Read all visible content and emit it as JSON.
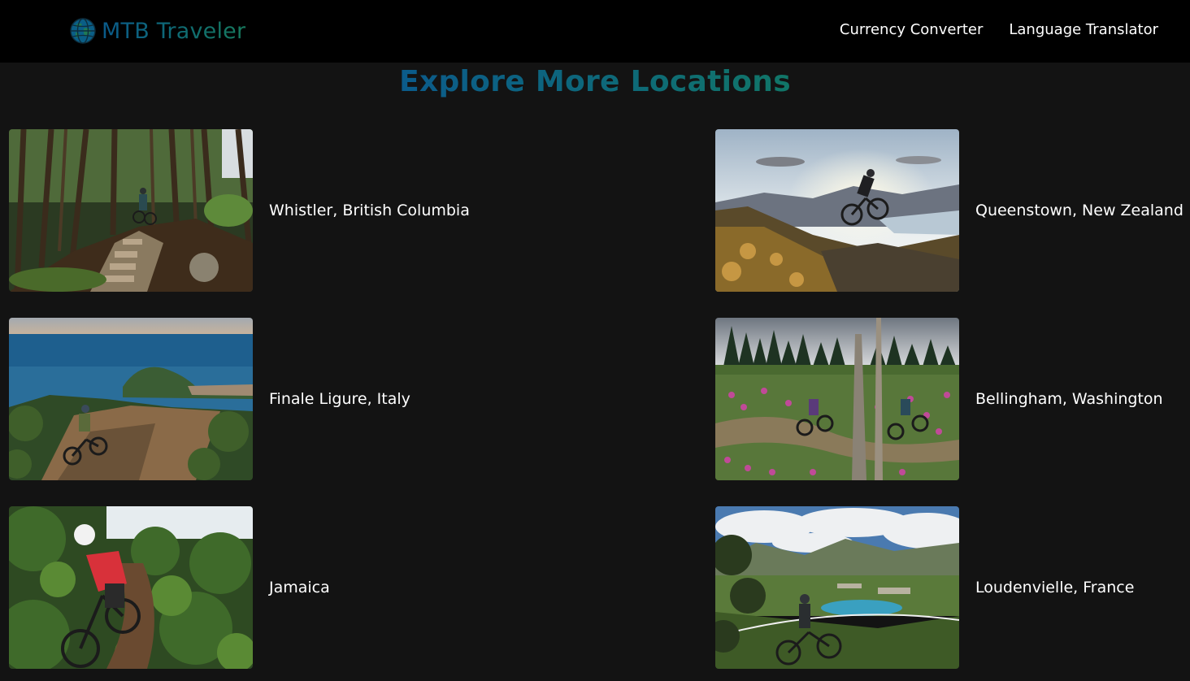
{
  "brand": {
    "name": "MTB Traveler",
    "icon": "globe-icon",
    "colors": {
      "gradient_start": "#0a5a8a",
      "gradient_end": "#177a5e"
    }
  },
  "nav": {
    "links": [
      {
        "label": "Currency Converter"
      },
      {
        "label": "Language Translator"
      }
    ]
  },
  "main": {
    "heading": "Explore More Locations",
    "locations": [
      {
        "name": "Whistler, British Columbia",
        "image": "forest-trail-rider"
      },
      {
        "name": "Queenstown, New Zealand",
        "image": "sunset-hill-rider"
      },
      {
        "name": "Finale Ligure, Italy",
        "image": "coastal-cliff-rider"
      },
      {
        "name": "Bellingham, Washington",
        "image": "wildflower-meadow-riders"
      },
      {
        "name": "Jamaica",
        "image": "jungle-trail-rider"
      },
      {
        "name": "Loudenvielle, France",
        "image": "alpine-valley-rider"
      }
    ]
  },
  "colors": {
    "background": "#131313",
    "navbar": "#000000",
    "text": "#ffffff"
  }
}
